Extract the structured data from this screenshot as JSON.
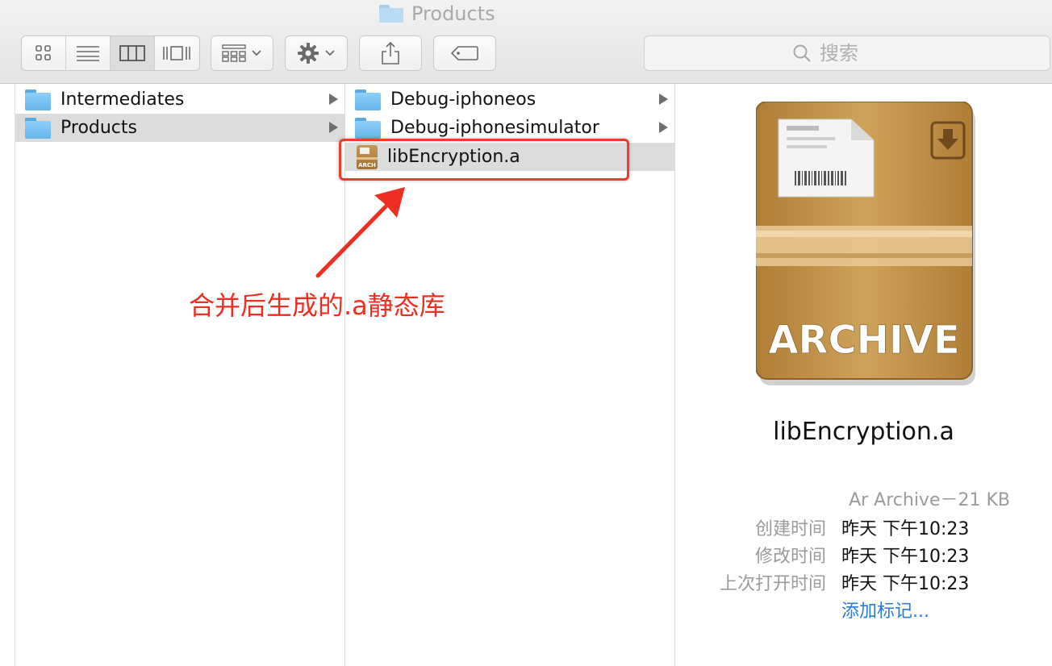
{
  "window": {
    "title": "Products"
  },
  "toolbar": {
    "view_buttons": [
      "icon-view-icon",
      "list-view-icon",
      "column-view-icon",
      "coverflow-view-icon"
    ],
    "search_placeholder": "搜索"
  },
  "columns": {
    "col1": {
      "items": [
        {
          "label": "Intermediates",
          "type": "folder",
          "selected": false
        },
        {
          "label": "Products",
          "type": "folder",
          "selected": true
        }
      ]
    },
    "col2": {
      "items": [
        {
          "label": "Debug-iphoneos",
          "type": "folder",
          "selected": false
        },
        {
          "label": "Debug-iphonesimulator",
          "type": "folder",
          "selected": false
        },
        {
          "label": "libEncryption.a",
          "type": "archive",
          "selected": true,
          "icon_text": "ARCH"
        }
      ]
    }
  },
  "annotation": {
    "text": "合并后生成的.a静态库",
    "color": "#ee2e22"
  },
  "preview": {
    "icon_label": "ARCHIVE",
    "filename": "libEncryption.a",
    "kind_size": "Ar Archive－21 KB",
    "meta": [
      {
        "key": "创建时间",
        "value": "昨天 下午10:23"
      },
      {
        "key": "修改时间",
        "value": "昨天 下午10:23"
      },
      {
        "key": "上次打开时间",
        "value": "昨天 下午10:23"
      }
    ],
    "add_tags": "添加标记..."
  },
  "colors": {
    "selection": "#dcdcdc",
    "folder_blue": "#63b4ea",
    "link_blue": "#2a7bd9"
  }
}
